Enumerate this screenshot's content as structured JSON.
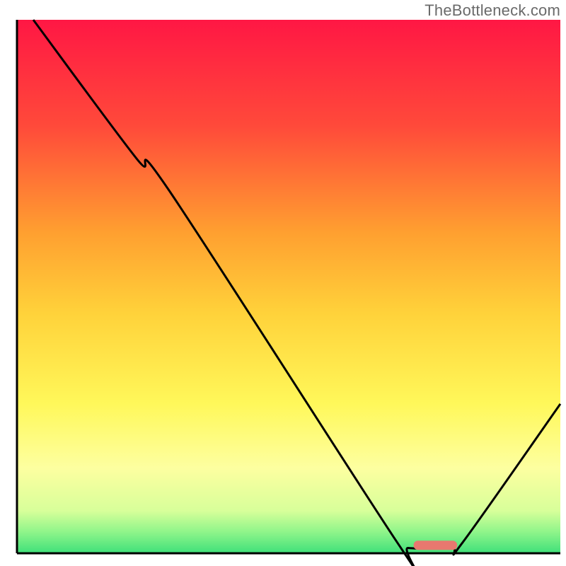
{
  "watermark": "TheBottleneck.com",
  "chart_data": {
    "type": "line",
    "title": "",
    "xlabel": "",
    "ylabel": "",
    "xlim": [
      0,
      100
    ],
    "ylim": [
      0,
      100
    ],
    "curve_points": [
      {
        "x": 3,
        "y": 100
      },
      {
        "x": 22,
        "y": 74
      },
      {
        "x": 28,
        "y": 68
      },
      {
        "x": 70,
        "y": 2
      },
      {
        "x": 72,
        "y": 1
      },
      {
        "x": 80,
        "y": 1
      },
      {
        "x": 82,
        "y": 2
      },
      {
        "x": 100,
        "y": 28
      }
    ],
    "marker": {
      "x_start": 73,
      "x_end": 81,
      "y": 1.5,
      "color": "#e8786f"
    },
    "gradient_stops": [
      {
        "offset": 0,
        "color": "#ff1744"
      },
      {
        "offset": 20,
        "color": "#ff4a3a"
      },
      {
        "offset": 40,
        "color": "#ffa030"
      },
      {
        "offset": 55,
        "color": "#ffd23a"
      },
      {
        "offset": 72,
        "color": "#fff85a"
      },
      {
        "offset": 84,
        "color": "#fdffa0"
      },
      {
        "offset": 92,
        "color": "#d8ff9a"
      },
      {
        "offset": 96,
        "color": "#8ff58a"
      },
      {
        "offset": 100,
        "color": "#3fe07a"
      }
    ],
    "axis_color": "#000000",
    "curve_color": "#000000"
  }
}
